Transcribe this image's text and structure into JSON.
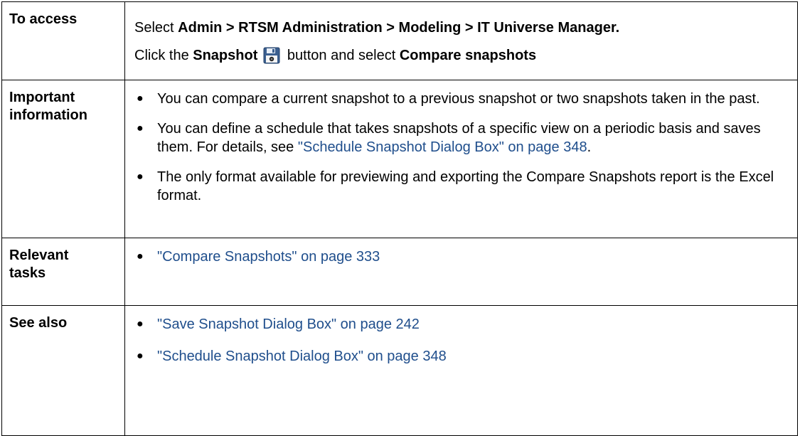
{
  "rows": {
    "access": {
      "label": "To access",
      "line1": {
        "prefix": "Select ",
        "path": "Admin > RTSM Administration > Modeling > IT Universe Manager."
      },
      "line2": {
        "prefix": "Click the ",
        "button_name": "Snapshot",
        "middle": " button and select ",
        "action": "Compare snapshots"
      },
      "icon": "floppy-disk-icon"
    },
    "important": {
      "label_line1": "Important",
      "label_line2": "information",
      "bullets": [
        {
          "text": "You can compare a current snapshot to a previous snapshot or two snapshots taken in the past."
        },
        {
          "text": "You can define a schedule that takes snapshots of a specific view on a periodic basis and saves them. For details, see ",
          "link": "\"Schedule Snapshot Dialog Box\" on page 348",
          "suffix": "."
        },
        {
          "text": "The only format available for previewing and exporting the Compare Snapshots report is the Excel format."
        }
      ]
    },
    "tasks": {
      "label_line1": "Relevant",
      "label_line2": "tasks",
      "links": [
        "\"Compare Snapshots\" on page 333"
      ]
    },
    "see_also": {
      "label": "See also",
      "links": [
        "\"Save Snapshot Dialog Box\" on page 242",
        "\"Schedule Snapshot Dialog Box\" on page 348"
      ]
    }
  },
  "bullet_char": "●",
  "colors": {
    "link": "#1f4e8c",
    "border": "#000000",
    "text": "#000000"
  }
}
